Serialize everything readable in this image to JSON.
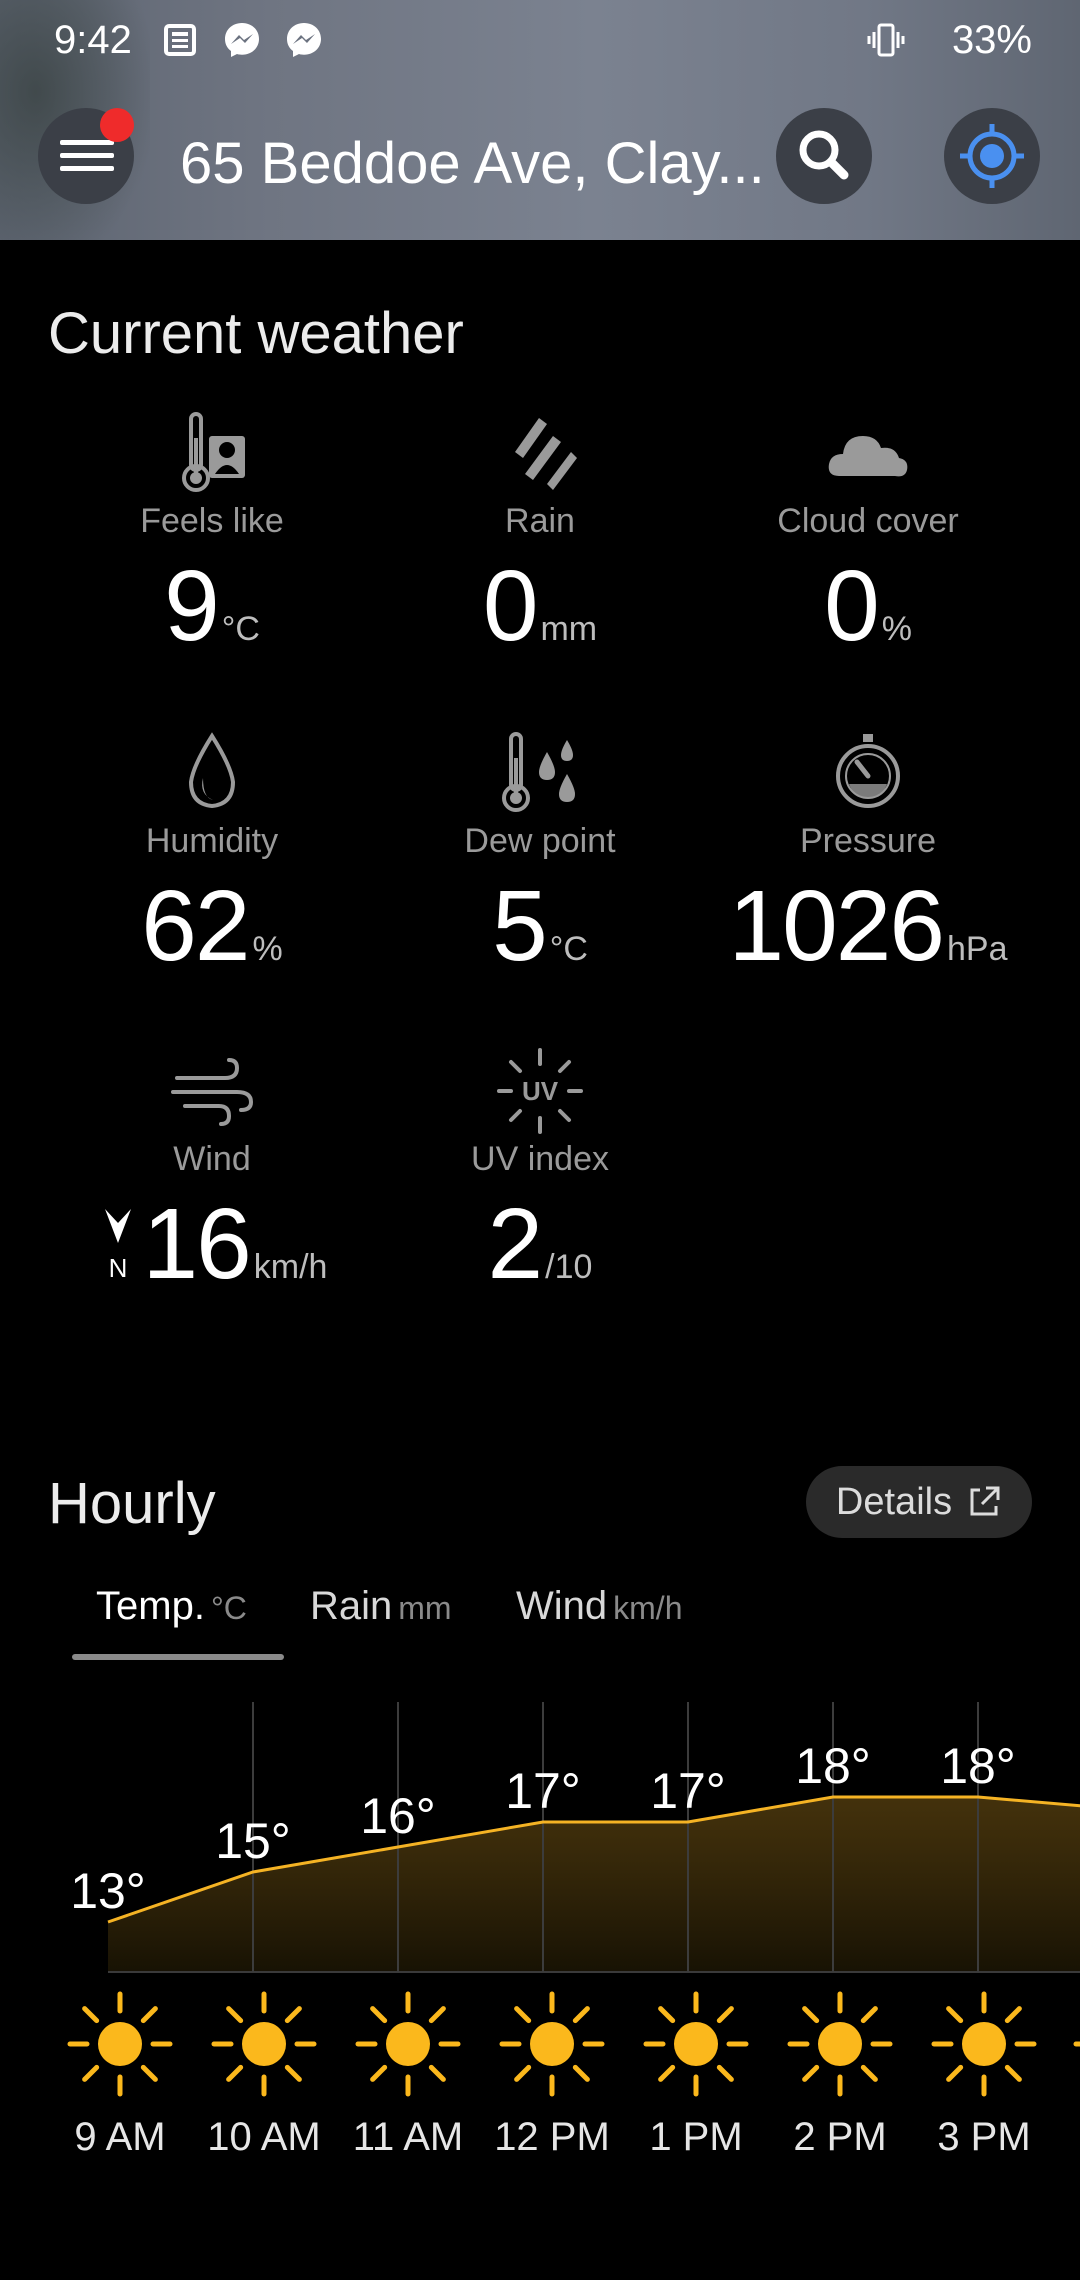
{
  "status_bar": {
    "time": "9:42",
    "icons": [
      "news-icon",
      "messenger-icon",
      "messenger-icon"
    ],
    "vibrate_icon": "vibrate-icon",
    "battery": "33%"
  },
  "header": {
    "location": "65 Beddoe Ave, Clay...",
    "menu_icon": "hamburger-menu-icon",
    "search_icon": "search-icon",
    "locate_icon": "my-location-icon",
    "notification_color": "#ef2b2b",
    "accent": "#4a90f0"
  },
  "current": {
    "title": "Current weather",
    "items": [
      {
        "label": "Feels like",
        "value": "9",
        "unit": "°C",
        "icon": "feels-like-thermometer-icon"
      },
      {
        "label": "Rain",
        "value": "0",
        "unit": "mm",
        "icon": "rain-icon"
      },
      {
        "label": "Cloud cover",
        "value": "0",
        "unit": "%",
        "icon": "cloud-icon"
      },
      {
        "label": "Humidity",
        "value": "62",
        "unit": "%",
        "icon": "humidity-drop-icon"
      },
      {
        "label": "Dew point",
        "value": "5",
        "unit": "°C",
        "icon": "dew-point-icon"
      },
      {
        "label": "Pressure",
        "value": "1026",
        "unit": "hPa",
        "icon": "pressure-gauge-icon"
      },
      {
        "label": "Wind",
        "value": "16",
        "unit": "km/h",
        "icon": "wind-icon",
        "direction": "N"
      },
      {
        "label": "UV index",
        "value": "2",
        "unit": "/10",
        "icon": "uv-index-icon"
      }
    ]
  },
  "hourly": {
    "title": "Hourly",
    "details_label": "Details",
    "details_icon": "external-link-icon",
    "tabs": [
      {
        "label": "Temp.",
        "unit": "°C",
        "selected": true
      },
      {
        "label": "Rain",
        "unit": "mm",
        "selected": false
      },
      {
        "label": "Wind",
        "unit": "km/h",
        "selected": false
      }
    ],
    "line_color": "#f5b324",
    "sun_color": "#fbb81c"
  },
  "chart_data": {
    "type": "area",
    "categories": [
      "9 AM",
      "10 AM",
      "11 AM",
      "12 PM",
      "1 PM",
      "2 PM",
      "3 PM"
    ],
    "values": [
      13,
      15,
      16,
      17,
      17,
      18,
      18
    ],
    "value_labels": [
      "13°",
      "15°",
      "16°",
      "17°",
      "17°",
      "18°",
      "18°"
    ],
    "conditions": [
      "sunny",
      "sunny",
      "sunny",
      "sunny",
      "sunny",
      "sunny",
      "sunny"
    ]
  }
}
